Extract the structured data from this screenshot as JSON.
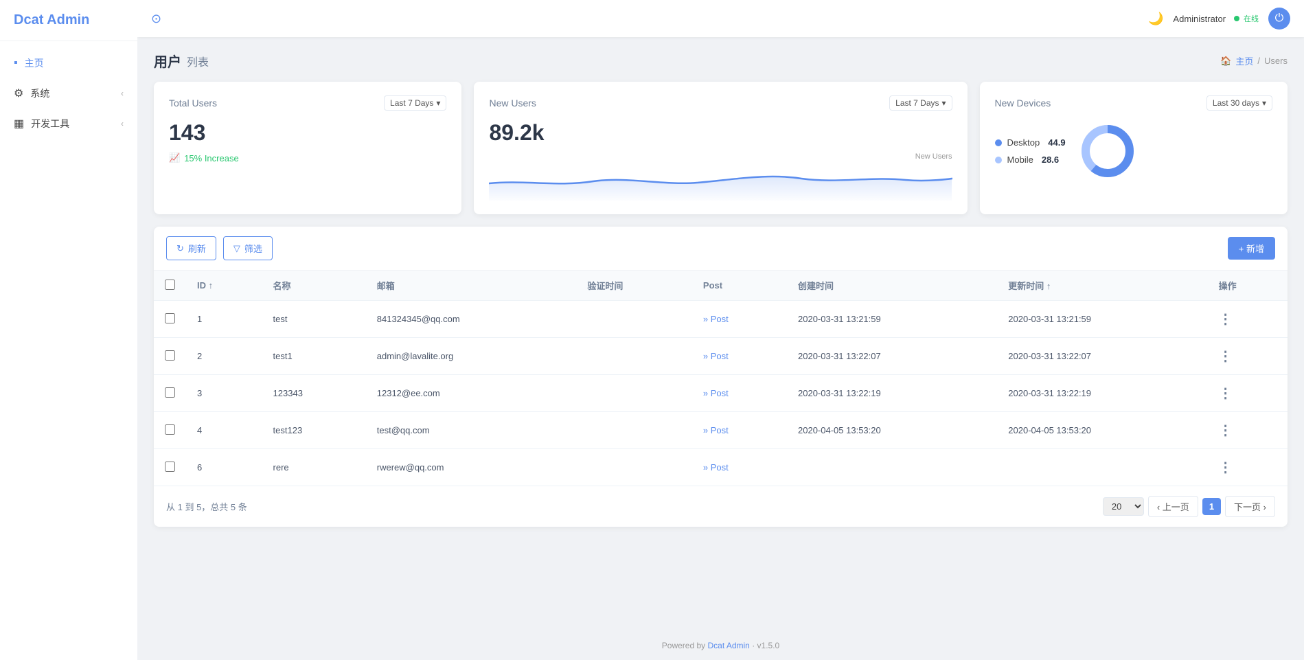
{
  "app": {
    "title": "Dcat Admin"
  },
  "sidebar": {
    "nav_items": [
      {
        "id": "home",
        "label": "主页",
        "icon": "■",
        "active": true,
        "has_chevron": false
      },
      {
        "id": "system",
        "label": "系统",
        "icon": "⚙",
        "active": false,
        "has_chevron": true
      },
      {
        "id": "devtools",
        "label": "开发工具",
        "icon": "▦",
        "active": false,
        "has_chevron": true
      }
    ]
  },
  "topbar": {
    "refresh_icon": "⊙",
    "moon_icon": "☽",
    "user_name": "Administrator",
    "user_status": "在线",
    "power_icon": "⏻"
  },
  "page": {
    "title": "用户",
    "subtitle": "列表",
    "breadcrumb_home": "主页",
    "breadcrumb_current": "Users"
  },
  "stats": {
    "total_users": {
      "label": "Total Users",
      "value": "143",
      "increase": "15% Increase",
      "dropdown_label": "Last 7 Days"
    },
    "new_users": {
      "label": "New Users",
      "value": "89.2k",
      "dropdown_label": "Last 7 Days",
      "chart_label": "New Users"
    },
    "new_devices": {
      "label": "New Devices",
      "dropdown_label": "Last 30 days",
      "desktop_label": "Desktop",
      "desktop_value": "44.9",
      "mobile_label": "Mobile",
      "mobile_value": "28.6"
    }
  },
  "toolbar": {
    "refresh_label": "刷新",
    "filter_label": "筛选",
    "add_label": "+ 新增"
  },
  "table": {
    "columns": [
      "ID ↑",
      "名称",
      "邮箱",
      "验证时间",
      "Post",
      "创建时间",
      "更新时间 ↑",
      "操作"
    ],
    "rows": [
      {
        "id": "1",
        "name": "test",
        "email": "841324345@qq.com",
        "verify_time": "",
        "post": "» Post",
        "created_at": "2020-03-31 13:21:59",
        "updated_at": "2020-03-31 13:21:59"
      },
      {
        "id": "2",
        "name": "test1",
        "email": "admin@lavalite.org",
        "verify_time": "",
        "post": "» Post",
        "created_at": "2020-03-31 13:22:07",
        "updated_at": "2020-03-31 13:22:07"
      },
      {
        "id": "3",
        "name": "123343",
        "email": "12312@ee.com",
        "verify_time": "",
        "post": "» Post",
        "created_at": "2020-03-31 13:22:19",
        "updated_at": "2020-03-31 13:22:19"
      },
      {
        "id": "4",
        "name": "test123",
        "email": "test@qq.com",
        "verify_time": "",
        "post": "» Post",
        "created_at": "2020-04-05 13:53:20",
        "updated_at": "2020-04-05 13:53:20"
      },
      {
        "id": "6",
        "name": "rere",
        "email": "rwerew@qq.com",
        "verify_time": "",
        "post": "» Post",
        "created_at": "",
        "updated_at": ""
      }
    ]
  },
  "pagination": {
    "info": "从 1 到 5，总共 5 条",
    "page_size": "20",
    "prev_label": "‹ 上一页",
    "current_page": "1",
    "next_label": "下一页 ›"
  },
  "footer": {
    "text": "Powered by",
    "brand": "Dcat Admin",
    "version": "· v1.5.0"
  }
}
